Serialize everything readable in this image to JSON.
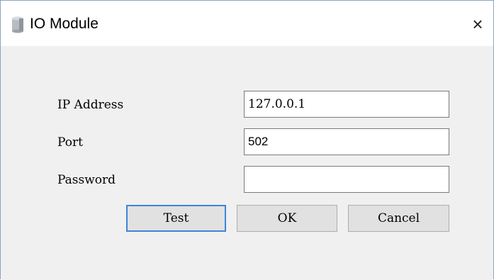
{
  "window": {
    "title": "IO Module",
    "close_glyph": "×",
    "icon": "cylinder-icon"
  },
  "form": {
    "ip_label": "IP Address",
    "ip_value": "127.0.0.1",
    "port_label": "Port",
    "port_value": "502",
    "password_label": "Password",
    "password_value": ""
  },
  "buttons": {
    "test": "Test",
    "ok": "OK",
    "cancel": "Cancel"
  },
  "colors": {
    "accent": "#3b86d8",
    "button_face": "#e1e1e1",
    "client_bg": "#f0f0f0"
  }
}
